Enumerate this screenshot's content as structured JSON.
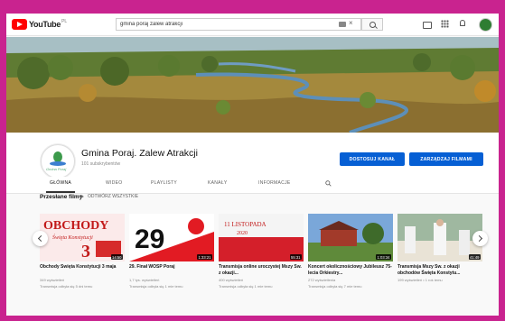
{
  "header": {
    "logo_text": "YouTube",
    "logo_country": "PL",
    "search_value": "gmina poraj zalew atrakcji",
    "clear_glyph": "×"
  },
  "channel": {
    "name": "Gmina Poraj. Zalew Atrakcji",
    "subscribers": "101 subskrybentów",
    "avatar_caption": "Gmina Poraj",
    "customize_button": "DOSTOSUJ KANAŁ",
    "manage_button": "ZARZĄDZAJ FILMAMI"
  },
  "tabs": [
    {
      "label": "GŁÓWNA",
      "active": true
    },
    {
      "label": "WIDEO",
      "active": false
    },
    {
      "label": "PLAYLISTY",
      "active": false
    },
    {
      "label": "KANAŁY",
      "active": false
    },
    {
      "label": "INFORMACJE",
      "active": false
    }
  ],
  "section": {
    "title": "Przesłane filmy",
    "play_all": "ODTWÓRZ WSZYSTKIE"
  },
  "videos": [
    {
      "title": "Obchody Święta Konstytucji 3 maja",
      "duration": "14:50",
      "views": "349 wyświetleń",
      "age": "Transmisja odbyła się 5 dni temu",
      "thumb_text": "OBCHODY",
      "thumb_sub": "Święta Konstytucji",
      "thumb_num": "3"
    },
    {
      "title": "29. Finał WOŚP Poraj",
      "duration": "1:33:21",
      "views": "1,7 tys. wyświetleń",
      "age": "Transmisja odbyła się 1 mie temu",
      "thumb_text": "29",
      "thumb_sub": "",
      "thumb_num": ""
    },
    {
      "title": "Transmisja online uroczystej Mszy Św. z okazji...",
      "duration": "55:31",
      "views": "400 wyświetleń",
      "age": "Transmisja odbyła się 1 mie temu",
      "thumb_text": "11 LISTOPADA",
      "thumb_sub": "2020",
      "thumb_num": ""
    },
    {
      "title": "Koncert okolicznościowy Jubileusz 75-lecia Orkiestry...",
      "duration": "1:03:34",
      "views": "272 wyświetlenia",
      "age": "Transmisja odbyła się 7 mie temu",
      "thumb_text": "",
      "thumb_sub": "",
      "thumb_num": ""
    },
    {
      "title": "Transmisja Mszy Św. z okazji obchodów Święta Konstytu...",
      "duration": "41:49",
      "views": "199 wyświetleń • 1 rok temu",
      "age": "",
      "thumb_text": "",
      "thumb_sub": "",
      "thumb_num": ""
    }
  ],
  "icons": {
    "search": "search-icon",
    "camera": "video-camera-icon",
    "apps": "apps-grid-icon",
    "bell": "bell-icon",
    "mic_kbd": "keyboard-icon"
  }
}
